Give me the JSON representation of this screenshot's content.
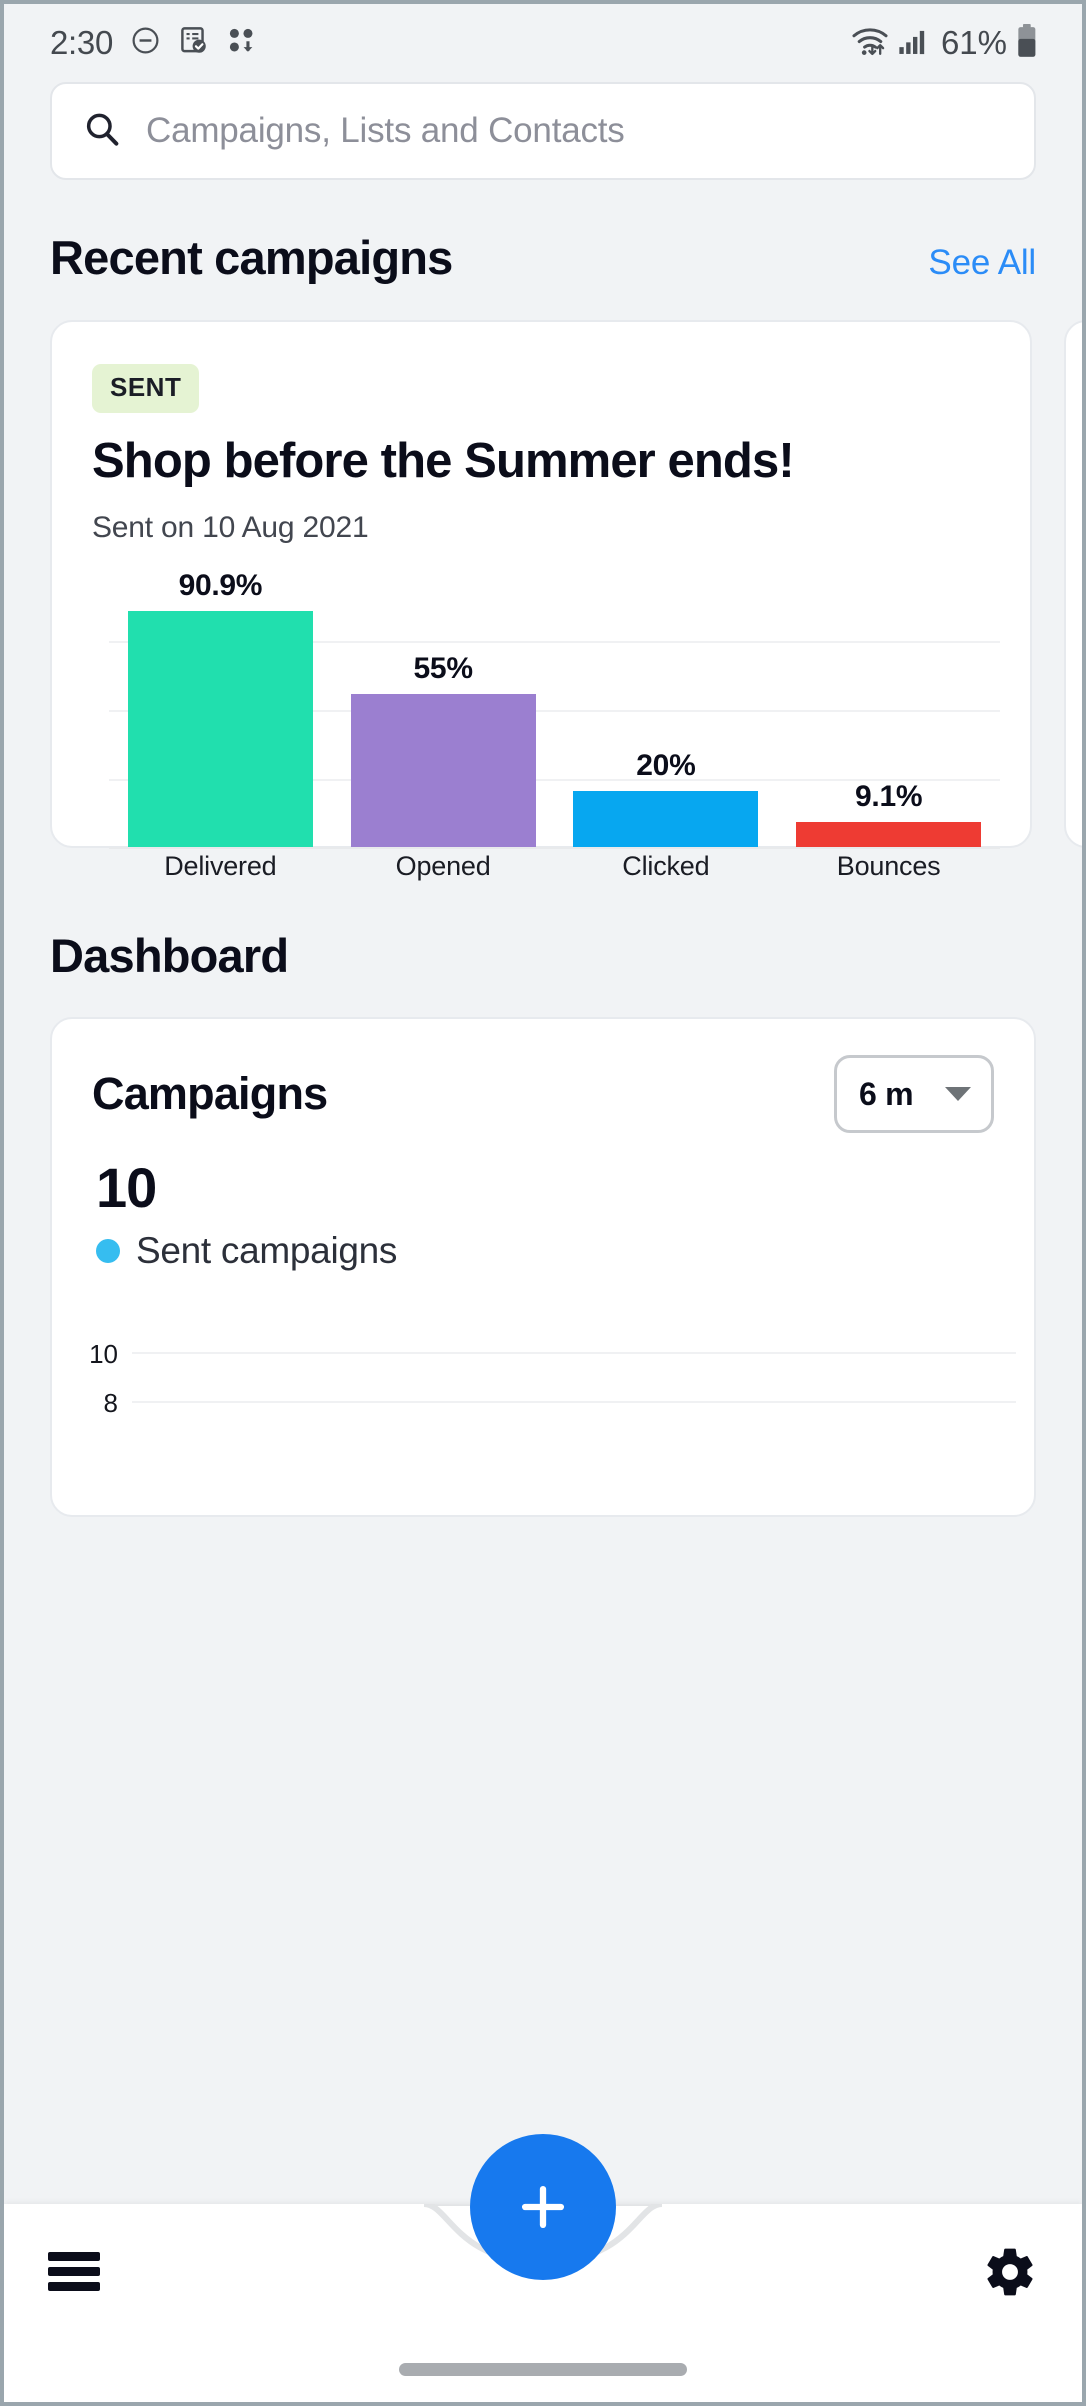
{
  "statusbar": {
    "time": "2:30",
    "battery_pct": "61%",
    "icons": [
      "do-not-disturb-icon",
      "note-check-icon",
      "dots-download-icon",
      "wifi-icon",
      "signal-icon",
      "battery-icon"
    ]
  },
  "search": {
    "placeholder": "Campaigns, Lists and Contacts",
    "value": ""
  },
  "recent": {
    "title": "Recent campaigns",
    "see_all": "See All",
    "card": {
      "status": "SENT",
      "title": "Shop before the Summer ends!",
      "date": "Sent on 10 Aug 2021"
    }
  },
  "dashboard": {
    "title": "Dashboard",
    "card": {
      "title": "Campaigns",
      "range": "6 m",
      "stat_value": "10",
      "stat_label": "Sent campaigns",
      "legend_color": "#36bdf0"
    }
  },
  "bottom_nav": {
    "menu_icon": "hamburger-menu-icon",
    "add_icon": "plus-icon",
    "settings_icon": "gear-icon",
    "fab_color": "#1779ee"
  },
  "chart_data": [
    {
      "type": "bar",
      "title": "Shop before the Summer ends!",
      "categories": [
        "Delivered",
        "Opened",
        "Clicked",
        "Bounces"
      ],
      "values": [
        90.9,
        55,
        20,
        9.1
      ],
      "value_labels": [
        "90.9%",
        "55%",
        "20%",
        "9.1%"
      ],
      "colors": [
        "#21dfae",
        "#9b7fd0",
        "#07a7f0",
        "#ee3b33"
      ],
      "xlabel": "",
      "ylabel": "",
      "ylim": [
        0,
        100
      ],
      "grid": true,
      "gridlines": [
        25,
        50,
        75
      ],
      "legend": "none"
    },
    {
      "type": "line",
      "title": "Campaigns",
      "series": [
        {
          "name": "Sent campaigns",
          "values": []
        }
      ],
      "yticks": [
        "10",
        "8"
      ],
      "ylim": [
        8,
        10
      ],
      "grid": true,
      "legend": "top-left",
      "note": "chart clipped by bottom navigation bar"
    }
  ]
}
